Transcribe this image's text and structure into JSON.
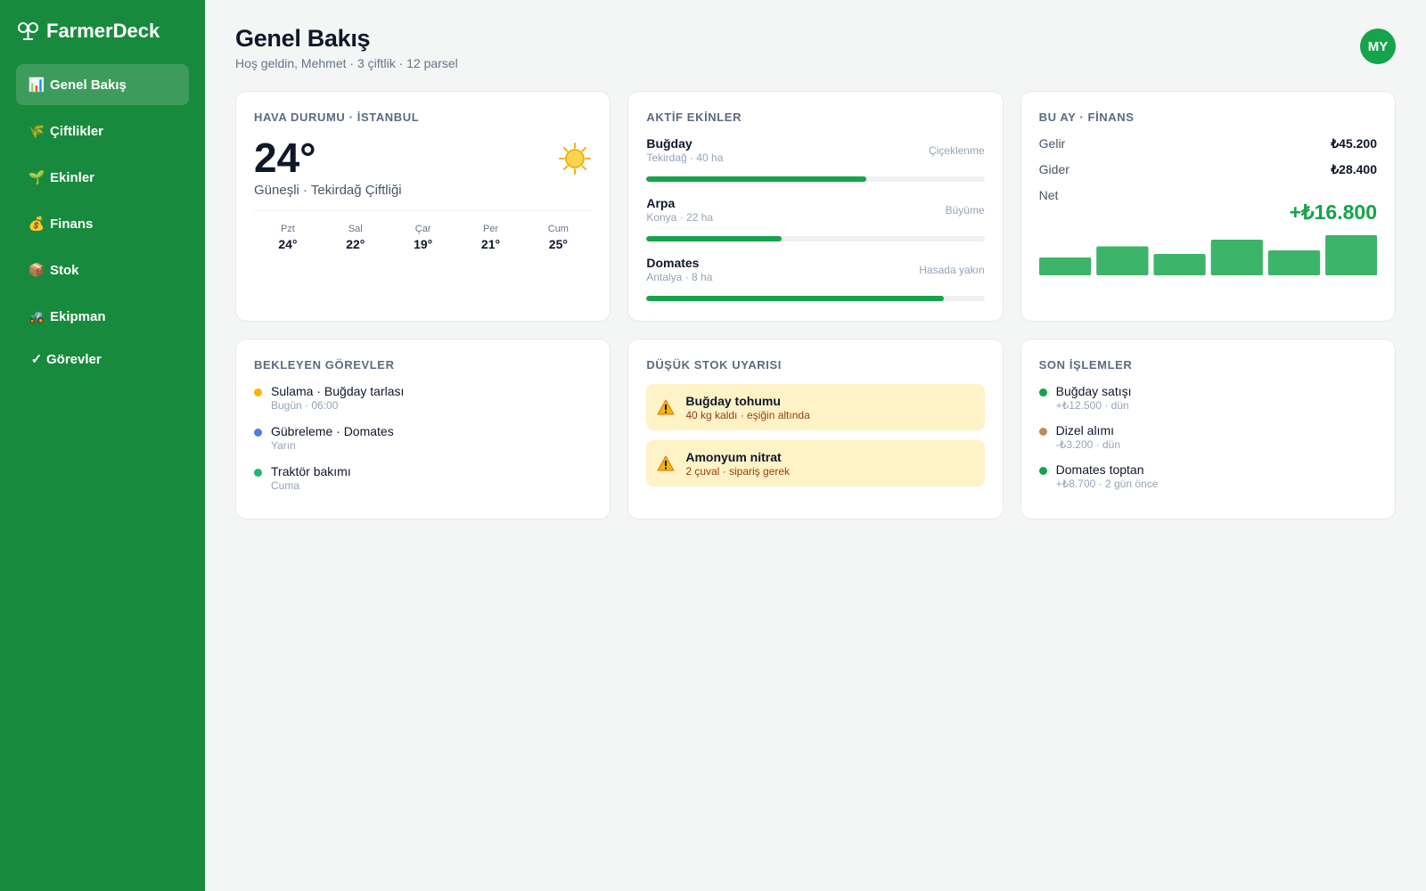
{
  "app": {
    "name": "FarmerDeck"
  },
  "sidebar": {
    "items": [
      {
        "icon": "📊",
        "label": "Genel Bakış",
        "active": true
      },
      {
        "icon": "🌾",
        "label": "Çiftlikler"
      },
      {
        "icon": "🌱",
        "label": "Ekinler"
      },
      {
        "icon": "💰",
        "label": "Finans"
      },
      {
        "icon": "📦",
        "label": "Stok"
      },
      {
        "icon": "🚜",
        "label": "Ekipman"
      },
      {
        "icon": "✓",
        "label": "Görevler"
      }
    ]
  },
  "header": {
    "title": "Genel Bakış",
    "subtitle": "Hoş geldin, Mehmet · 3 çiftlik · 12 parsel",
    "avatar_initials": "MY"
  },
  "weather": {
    "title": "HAVA DURUMU · İSTANBUL",
    "temp": "24°",
    "desc": "Güneşli · Tekirdağ Çiftliği",
    "icon": "sun-icon",
    "forecast": [
      {
        "day": "Pzt",
        "temp": "24°"
      },
      {
        "day": "Sal",
        "temp": "22°"
      },
      {
        "day": "Çar",
        "temp": "19°"
      },
      {
        "day": "Per",
        "temp": "21°"
      },
      {
        "day": "Cum",
        "temp": "25°"
      }
    ]
  },
  "crops": {
    "title": "AKTİF EKİNLER",
    "items": [
      {
        "name": "Buğday",
        "meta": "Tekirdağ · 40 ha",
        "stage": "Çiçeklenme",
        "progress": 0.65
      },
      {
        "name": "Arpa",
        "meta": "Konya · 22 ha",
        "stage": "Büyüme",
        "progress": 0.4
      },
      {
        "name": "Domates",
        "meta": "Antalya · 8 ha",
        "stage": "Hasada yakın",
        "progress": 0.88
      }
    ]
  },
  "finance": {
    "title": "BU AY · FİNANS",
    "income_label": "Gelir",
    "income": "₺45.200",
    "expense_label": "Gider",
    "expense": "₺28.400",
    "net_label": "Net",
    "net": "+₺16.800",
    "chart_color": "#3cb46a",
    "bars": [
      0.4,
      0.65,
      0.48,
      0.8,
      0.56,
      0.9
    ]
  },
  "tasks": {
    "title": "BEKLEYEN GÖREVLER",
    "items": [
      {
        "title": "Sulama · Buğday tarlası",
        "sub": "Bugün · 06:00",
        "color": "#f5b50b"
      },
      {
        "title": "Gübreleme · Domates",
        "sub": "Yarın",
        "color": "#4a7fe0"
      },
      {
        "title": "Traktör bakımı",
        "sub": "Cuma",
        "color": "#22b573"
      }
    ]
  },
  "stock": {
    "title": "DÜŞÜK STOK UYARISI",
    "items": [
      {
        "title": "Buğday tohumu",
        "sub": "40 kg kaldı · eşiğin altında"
      },
      {
        "title": "Amonyum nitrat",
        "sub": "2 çuval · sipariş gerek"
      }
    ]
  },
  "transactions": {
    "title": "SON İŞLEMLER",
    "items": [
      {
        "title": "Buğday satışı",
        "sub": "+₺12.500 · dün",
        "color": "#16a34a"
      },
      {
        "title": "Dizel alımı",
        "sub": "-₺3.200 · dün",
        "color": "#c2875a"
      },
      {
        "title": "Domates toptan",
        "sub": "+₺8.700 · 2 gün önce",
        "color": "#16a34a"
      }
    ]
  }
}
